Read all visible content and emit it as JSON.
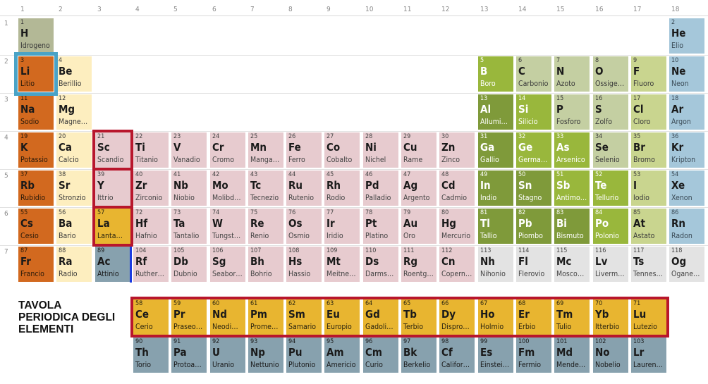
{
  "title": [
    "TAVOLA",
    "PERIODICA DEGLI",
    "ELEMENTI"
  ],
  "group_numbers": [
    "1",
    "2",
    "3",
    "4",
    "5",
    "6",
    "7",
    "8",
    "9",
    "10",
    "11",
    "12",
    "13",
    "14",
    "15",
    "16",
    "17",
    "18"
  ],
  "period_numbers": [
    "1",
    "2",
    "3",
    "4",
    "5",
    "6",
    "7"
  ],
  "colors": {
    "alkali": "#d2691f",
    "alkaline": "#fdeebf",
    "transition": "#e7cbcf",
    "post_transition": "#7f9a3a",
    "metalloid": "#99b73c",
    "nonmetal": "#c4cfa2",
    "halogen": "#c9d58f",
    "noble": "#a5c7da",
    "hydrogen": "#b3b896",
    "lanthanide": "#e8b530",
    "actinide": "#87a1ae",
    "unknown": "#e3e3e3",
    "highlight_red": "#b8162c",
    "highlight_blue": "#4aa3c6",
    "actinium_bar": "#1b3be0"
  },
  "elements": [
    {
      "n": "1",
      "s": "H",
      "name": "Idrogeno",
      "g": 1,
      "p": 1,
      "c": "hydrogen"
    },
    {
      "n": "2",
      "s": "He",
      "name": "Elio",
      "g": 18,
      "p": 1,
      "c": "noble"
    },
    {
      "n": "3",
      "s": "Li",
      "name": "Litio",
      "g": 1,
      "p": 2,
      "c": "alkali"
    },
    {
      "n": "4",
      "s": "Be",
      "name": "Berillio",
      "g": 2,
      "p": 2,
      "c": "alkaline"
    },
    {
      "n": "5",
      "s": "B",
      "name": "Boro",
      "g": 13,
      "p": 2,
      "c": "metalloid"
    },
    {
      "n": "6",
      "s": "C",
      "name": "Carbonio",
      "g": 14,
      "p": 2,
      "c": "nonmetal"
    },
    {
      "n": "7",
      "s": "N",
      "name": "Azoto",
      "g": 15,
      "p": 2,
      "c": "nonmetal"
    },
    {
      "n": "8",
      "s": "O",
      "name": "Ossige…",
      "g": 16,
      "p": 2,
      "c": "nonmetal"
    },
    {
      "n": "9",
      "s": "F",
      "name": "Fluoro",
      "g": 17,
      "p": 2,
      "c": "halogen"
    },
    {
      "n": "10",
      "s": "Ne",
      "name": "Neon",
      "g": 18,
      "p": 2,
      "c": "noble"
    },
    {
      "n": "11",
      "s": "Na",
      "name": "Sodio",
      "g": 1,
      "p": 3,
      "c": "alkali"
    },
    {
      "n": "12",
      "s": "Mg",
      "name": "Magne…",
      "g": 2,
      "p": 3,
      "c": "alkaline"
    },
    {
      "n": "13",
      "s": "Al",
      "name": "Allumi…",
      "g": 13,
      "p": 3,
      "c": "post_transition"
    },
    {
      "n": "14",
      "s": "Si",
      "name": "Silicio",
      "g": 14,
      "p": 3,
      "c": "metalloid"
    },
    {
      "n": "15",
      "s": "P",
      "name": "Fosforo",
      "g": 15,
      "p": 3,
      "c": "nonmetal"
    },
    {
      "n": "16",
      "s": "S",
      "name": "Zolfo",
      "g": 16,
      "p": 3,
      "c": "nonmetal"
    },
    {
      "n": "17",
      "s": "Cl",
      "name": "Cloro",
      "g": 17,
      "p": 3,
      "c": "halogen"
    },
    {
      "n": "18",
      "s": "Ar",
      "name": "Argon",
      "g": 18,
      "p": 3,
      "c": "noble"
    },
    {
      "n": "19",
      "s": "K",
      "name": "Potassio",
      "g": 1,
      "p": 4,
      "c": "alkali"
    },
    {
      "n": "20",
      "s": "Ca",
      "name": "Calcio",
      "g": 2,
      "p": 4,
      "c": "alkaline"
    },
    {
      "n": "21",
      "s": "Sc",
      "name": "Scandio",
      "g": 3,
      "p": 4,
      "c": "transition"
    },
    {
      "n": "22",
      "s": "Ti",
      "name": "Titanio",
      "g": 4,
      "p": 4,
      "c": "transition"
    },
    {
      "n": "23",
      "s": "V",
      "name": "Vanadio",
      "g": 5,
      "p": 4,
      "c": "transition"
    },
    {
      "n": "24",
      "s": "Cr",
      "name": "Cromo",
      "g": 6,
      "p": 4,
      "c": "transition"
    },
    {
      "n": "25",
      "s": "Mn",
      "name": "Manga…",
      "g": 7,
      "p": 4,
      "c": "transition"
    },
    {
      "n": "26",
      "s": "Fe",
      "name": "Ferro",
      "g": 8,
      "p": 4,
      "c": "transition"
    },
    {
      "n": "27",
      "s": "Co",
      "name": "Cobalto",
      "g": 9,
      "p": 4,
      "c": "transition"
    },
    {
      "n": "28",
      "s": "Ni",
      "name": "Nichel",
      "g": 10,
      "p": 4,
      "c": "transition"
    },
    {
      "n": "29",
      "s": "Cu",
      "name": "Rame",
      "g": 11,
      "p": 4,
      "c": "transition"
    },
    {
      "n": "30",
      "s": "Zn",
      "name": "Zinco",
      "g": 12,
      "p": 4,
      "c": "transition"
    },
    {
      "n": "31",
      "s": "Ga",
      "name": "Gallio",
      "g": 13,
      "p": 4,
      "c": "post_transition"
    },
    {
      "n": "32",
      "s": "Ge",
      "name": "Germa…",
      "g": 14,
      "p": 4,
      "c": "metalloid"
    },
    {
      "n": "33",
      "s": "As",
      "name": "Arsenico",
      "g": 15,
      "p": 4,
      "c": "metalloid"
    },
    {
      "n": "34",
      "s": "Se",
      "name": "Selenio",
      "g": 16,
      "p": 4,
      "c": "nonmetal"
    },
    {
      "n": "35",
      "s": "Br",
      "name": "Bromo",
      "g": 17,
      "p": 4,
      "c": "halogen"
    },
    {
      "n": "36",
      "s": "Kr",
      "name": "Kripton",
      "g": 18,
      "p": 4,
      "c": "noble"
    },
    {
      "n": "37",
      "s": "Rb",
      "name": "Rubidio",
      "g": 1,
      "p": 5,
      "c": "alkali"
    },
    {
      "n": "38",
      "s": "Sr",
      "name": "Stronzio",
      "g": 2,
      "p": 5,
      "c": "alkaline"
    },
    {
      "n": "39",
      "s": "Y",
      "name": "Ittrio",
      "g": 3,
      "p": 5,
      "c": "transition"
    },
    {
      "n": "40",
      "s": "Zr",
      "name": "Zirconio",
      "g": 4,
      "p": 5,
      "c": "transition"
    },
    {
      "n": "41",
      "s": "Nb",
      "name": "Niobio",
      "g": 5,
      "p": 5,
      "c": "transition"
    },
    {
      "n": "42",
      "s": "Mo",
      "name": "Molibd…",
      "g": 6,
      "p": 5,
      "c": "transition"
    },
    {
      "n": "43",
      "s": "Tc",
      "name": "Tecnezio",
      "g": 7,
      "p": 5,
      "c": "transition"
    },
    {
      "n": "44",
      "s": "Ru",
      "name": "Rutenio",
      "g": 8,
      "p": 5,
      "c": "transition"
    },
    {
      "n": "45",
      "s": "Rh",
      "name": "Rodio",
      "g": 9,
      "p": 5,
      "c": "transition"
    },
    {
      "n": "46",
      "s": "Pd",
      "name": "Palladio",
      "g": 10,
      "p": 5,
      "c": "transition"
    },
    {
      "n": "47",
      "s": "Ag",
      "name": "Argento",
      "g": 11,
      "p": 5,
      "c": "transition"
    },
    {
      "n": "48",
      "s": "Cd",
      "name": "Cadmio",
      "g": 12,
      "p": 5,
      "c": "transition"
    },
    {
      "n": "49",
      "s": "In",
      "name": "Indio",
      "g": 13,
      "p": 5,
      "c": "post_transition"
    },
    {
      "n": "50",
      "s": "Sn",
      "name": "Stagno",
      "g": 14,
      "p": 5,
      "c": "post_transition"
    },
    {
      "n": "51",
      "s": "Sb",
      "name": "Antimo…",
      "g": 15,
      "p": 5,
      "c": "metalloid"
    },
    {
      "n": "52",
      "s": "Te",
      "name": "Tellurio",
      "g": 16,
      "p": 5,
      "c": "metalloid"
    },
    {
      "n": "53",
      "s": "I",
      "name": "Iodio",
      "g": 17,
      "p": 5,
      "c": "halogen"
    },
    {
      "n": "54",
      "s": "Xe",
      "name": "Xenon",
      "g": 18,
      "p": 5,
      "c": "noble"
    },
    {
      "n": "55",
      "s": "Cs",
      "name": "Cesio",
      "g": 1,
      "p": 6,
      "c": "alkali"
    },
    {
      "n": "56",
      "s": "Ba",
      "name": "Bario",
      "g": 2,
      "p": 6,
      "c": "alkaline"
    },
    {
      "n": "57",
      "s": "La",
      "name": "Lanta…",
      "g": 3,
      "p": 6,
      "c": "lanthanide"
    },
    {
      "n": "72",
      "s": "Hf",
      "name": "Hafnio",
      "g": 4,
      "p": 6,
      "c": "transition"
    },
    {
      "n": "73",
      "s": "Ta",
      "name": "Tantalio",
      "g": 5,
      "p": 6,
      "c": "transition"
    },
    {
      "n": "74",
      "s": "W",
      "name": "Tungst…",
      "g": 6,
      "p": 6,
      "c": "transition"
    },
    {
      "n": "75",
      "s": "Re",
      "name": "Renio",
      "g": 7,
      "p": 6,
      "c": "transition"
    },
    {
      "n": "76",
      "s": "Os",
      "name": "Osmio",
      "g": 8,
      "p": 6,
      "c": "transition"
    },
    {
      "n": "77",
      "s": "Ir",
      "name": "Iridio",
      "g": 9,
      "p": 6,
      "c": "transition"
    },
    {
      "n": "78",
      "s": "Pt",
      "name": "Platino",
      "g": 10,
      "p": 6,
      "c": "transition"
    },
    {
      "n": "79",
      "s": "Au",
      "name": "Oro",
      "g": 11,
      "p": 6,
      "c": "transition"
    },
    {
      "n": "80",
      "s": "Hg",
      "name": "Mercurio",
      "g": 12,
      "p": 6,
      "c": "transition"
    },
    {
      "n": "81",
      "s": "Tl",
      "name": "Tallio",
      "g": 13,
      "p": 6,
      "c": "post_transition"
    },
    {
      "n": "82",
      "s": "Pb",
      "name": "Piombo",
      "g": 14,
      "p": 6,
      "c": "post_transition"
    },
    {
      "n": "83",
      "s": "Bi",
      "name": "Bismuto",
      "g": 15,
      "p": 6,
      "c": "post_transition"
    },
    {
      "n": "84",
      "s": "Po",
      "name": "Polonio",
      "g": 16,
      "p": 6,
      "c": "metalloid"
    },
    {
      "n": "85",
      "s": "At",
      "name": "Astato",
      "g": 17,
      "p": 6,
      "c": "halogen"
    },
    {
      "n": "86",
      "s": "Rn",
      "name": "Radon",
      "g": 18,
      "p": 6,
      "c": "noble"
    },
    {
      "n": "87",
      "s": "Fr",
      "name": "Francio",
      "g": 1,
      "p": 7,
      "c": "alkali"
    },
    {
      "n": "88",
      "s": "Ra",
      "name": "Radio",
      "g": 2,
      "p": 7,
      "c": "alkaline"
    },
    {
      "n": "89",
      "s": "Ac",
      "name": "Attinio",
      "g": 3,
      "p": 7,
      "c": "actinide"
    },
    {
      "n": "104",
      "s": "Rf",
      "name": "Ruther…",
      "g": 4,
      "p": 7,
      "c": "transition"
    },
    {
      "n": "105",
      "s": "Db",
      "name": "Dubnio",
      "g": 5,
      "p": 7,
      "c": "transition"
    },
    {
      "n": "106",
      "s": "Sg",
      "name": "Seabor…",
      "g": 6,
      "p": 7,
      "c": "transition"
    },
    {
      "n": "107",
      "s": "Bh",
      "name": "Bohrio",
      "g": 7,
      "p": 7,
      "c": "transition"
    },
    {
      "n": "108",
      "s": "Hs",
      "name": "Hassio",
      "g": 8,
      "p": 7,
      "c": "transition"
    },
    {
      "n": "109",
      "s": "Mt",
      "name": "Meitne…",
      "g": 9,
      "p": 7,
      "c": "transition"
    },
    {
      "n": "110",
      "s": "Ds",
      "name": "Darms…",
      "g": 10,
      "p": 7,
      "c": "transition"
    },
    {
      "n": "111",
      "s": "Rg",
      "name": "Roentg…",
      "g": 11,
      "p": 7,
      "c": "transition"
    },
    {
      "n": "112",
      "s": "Cn",
      "name": "Copern…",
      "g": 12,
      "p": 7,
      "c": "transition"
    },
    {
      "n": "113",
      "s": "Nh",
      "name": "Nihonio",
      "g": 13,
      "p": 7,
      "c": "unknown"
    },
    {
      "n": "114",
      "s": "Fl",
      "name": "Flerovio",
      "g": 14,
      "p": 7,
      "c": "unknown"
    },
    {
      "n": "115",
      "s": "Mc",
      "name": "Mosco…",
      "g": 15,
      "p": 7,
      "c": "unknown"
    },
    {
      "n": "116",
      "s": "Lv",
      "name": "Liverm…",
      "g": 16,
      "p": 7,
      "c": "unknown"
    },
    {
      "n": "117",
      "s": "Ts",
      "name": "Tennes…",
      "g": 17,
      "p": 7,
      "c": "unknown"
    },
    {
      "n": "118",
      "s": "Og",
      "name": "Ogane…",
      "g": 18,
      "p": 7,
      "c": "unknown"
    },
    {
      "n": "58",
      "s": "Ce",
      "name": "Cerio",
      "g": 4,
      "p": 9,
      "c": "lanthanide"
    },
    {
      "n": "59",
      "s": "Pr",
      "name": "Praseo…",
      "g": 5,
      "p": 9,
      "c": "lanthanide"
    },
    {
      "n": "60",
      "s": "Nd",
      "name": "Neodi…",
      "g": 6,
      "p": 9,
      "c": "lanthanide"
    },
    {
      "n": "61",
      "s": "Pm",
      "name": "Prome…",
      "g": 7,
      "p": 9,
      "c": "lanthanide"
    },
    {
      "n": "62",
      "s": "Sm",
      "name": "Samario",
      "g": 8,
      "p": 9,
      "c": "lanthanide"
    },
    {
      "n": "63",
      "s": "Eu",
      "name": "Europio",
      "g": 9,
      "p": 9,
      "c": "lanthanide"
    },
    {
      "n": "64",
      "s": "Gd",
      "name": "Gadoli…",
      "g": 10,
      "p": 9,
      "c": "lanthanide"
    },
    {
      "n": "65",
      "s": "Tb",
      "name": "Terbio",
      "g": 11,
      "p": 9,
      "c": "lanthanide"
    },
    {
      "n": "66",
      "s": "Dy",
      "name": "Dispro…",
      "g": 12,
      "p": 9,
      "c": "lanthanide"
    },
    {
      "n": "67",
      "s": "Ho",
      "name": "Holmio",
      "g": 13,
      "p": 9,
      "c": "lanthanide"
    },
    {
      "n": "68",
      "s": "Er",
      "name": "Erbio",
      "g": 14,
      "p": 9,
      "c": "lanthanide"
    },
    {
      "n": "69",
      "s": "Tm",
      "name": "Tulio",
      "g": 15,
      "p": 9,
      "c": "lanthanide"
    },
    {
      "n": "70",
      "s": "Yb",
      "name": "Itterbio",
      "g": 16,
      "p": 9,
      "c": "lanthanide"
    },
    {
      "n": "71",
      "s": "Lu",
      "name": "Lutezio",
      "g": 17,
      "p": 9,
      "c": "lanthanide"
    },
    {
      "n": "90",
      "s": "Th",
      "name": "Torio",
      "g": 4,
      "p": 10,
      "c": "actinide"
    },
    {
      "n": "91",
      "s": "Pa",
      "name": "Protoa…",
      "g": 5,
      "p": 10,
      "c": "actinide"
    },
    {
      "n": "92",
      "s": "U",
      "name": "Uranio",
      "g": 6,
      "p": 10,
      "c": "actinide"
    },
    {
      "n": "93",
      "s": "Np",
      "name": "Nettunio",
      "g": 7,
      "p": 10,
      "c": "actinide"
    },
    {
      "n": "94",
      "s": "Pu",
      "name": "Plutonio",
      "g": 8,
      "p": 10,
      "c": "actinide"
    },
    {
      "n": "95",
      "s": "Am",
      "name": "Americio",
      "g": 9,
      "p": 10,
      "c": "actinide"
    },
    {
      "n": "96",
      "s": "Cm",
      "name": "Curio",
      "g": 10,
      "p": 10,
      "c": "actinide"
    },
    {
      "n": "97",
      "s": "Bk",
      "name": "Berkelio",
      "g": 11,
      "p": 10,
      "c": "actinide"
    },
    {
      "n": "98",
      "s": "Cf",
      "name": "Califor…",
      "g": 12,
      "p": 10,
      "c": "actinide"
    },
    {
      "n": "99",
      "s": "Es",
      "name": "Einstei…",
      "g": 13,
      "p": 10,
      "c": "actinide"
    },
    {
      "n": "100",
      "s": "Fm",
      "name": "Fermio",
      "g": 14,
      "p": 10,
      "c": "actinide"
    },
    {
      "n": "101",
      "s": "Md",
      "name": "Mende…",
      "g": 15,
      "p": 10,
      "c": "actinide"
    },
    {
      "n": "102",
      "s": "No",
      "name": "Nobelio",
      "g": 16,
      "p": 10,
      "c": "actinide"
    },
    {
      "n": "103",
      "s": "Lr",
      "name": "Lauren…",
      "g": 17,
      "p": 10,
      "c": "actinide"
    }
  ],
  "highlights": [
    {
      "target": "Li",
      "color": "highlight_blue"
    },
    {
      "target": "Sc",
      "color": "highlight_red"
    },
    {
      "target": "Y",
      "color": "highlight_red"
    },
    {
      "target": "La",
      "color": "highlight_red"
    },
    {
      "target": "lanthanide-row",
      "color": "highlight_red"
    }
  ]
}
